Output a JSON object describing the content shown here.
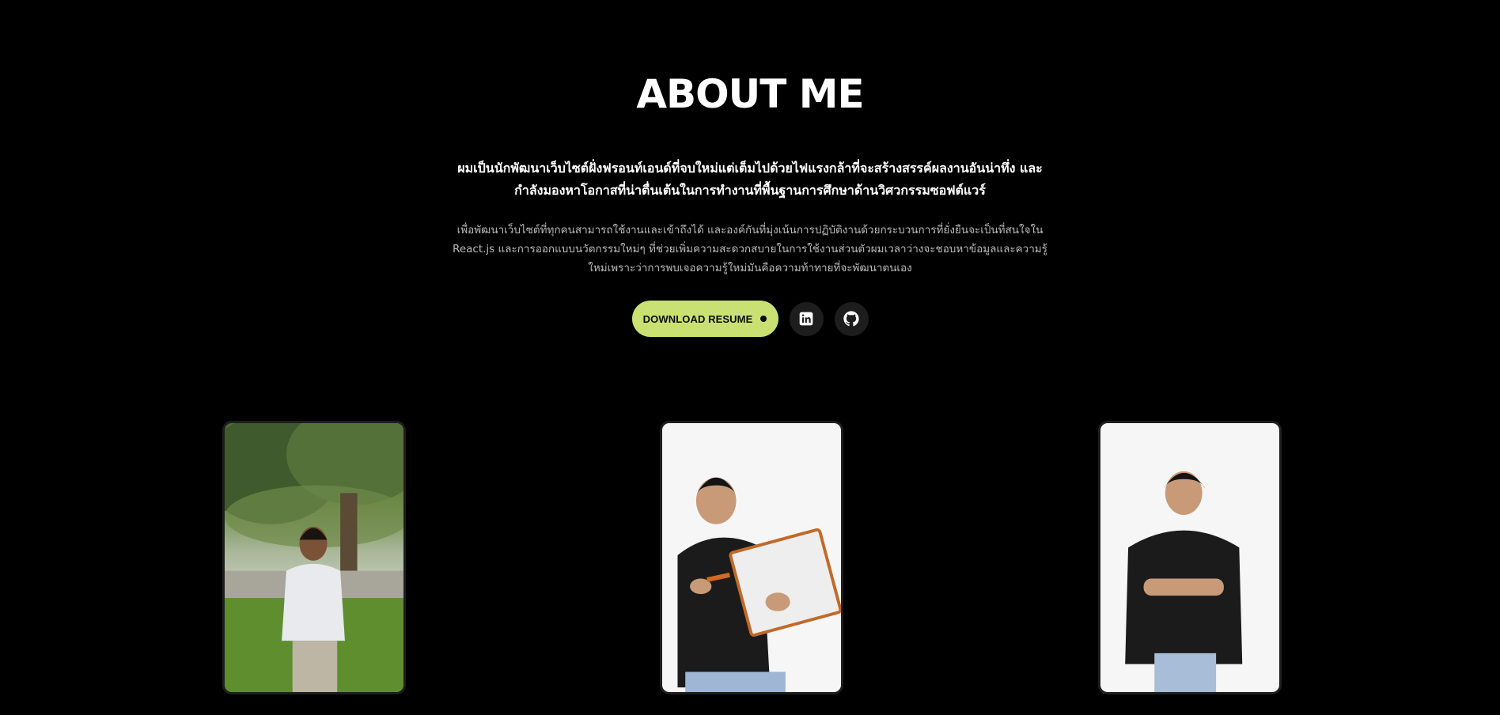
{
  "about": {
    "title": "ABOUT ME",
    "lead": "ผมเป็นนักพัฒนาเว็บไซต์ฝั่งฟรอนท์เอนด์ที่จบใหม่แต่เต็มไปด้วยไฟแรงกล้าที่จะสร้างสรรค์ผลงานอันน่าทึ่ง และกำลังมองหาโอกาสที่น่าตื่นเต้นในการทำงานที่พื้นฐานการศึกษาด้านวิศวกรรมซอฟต์แวร์",
    "body": "เพื่อพัฒนาเว็บไซต์ที่ทุกคนสามารถใช้งานและเข้าถึงได้ และองค์กันที่มุ่งเน้นการปฏิบัติงานด้วยกระบวนการที่ยั่งยืนจะเป็นที่สนใจใน React.js และการออกแบบนวัตกรรมใหม่ๆ ที่ช่วยเพิ่มความสะดวกสบายในการใช้งานส่วนตัวผมเวลาว่างจะชอบหาข้อมูลและความรู้ใหม่เพราะว่าการพบเจอความรู้ใหม่มันคือความท้าทายที่จะพัฒนาตนเอง"
  },
  "actions": {
    "resume_label": "DOWNLOAD RESUME",
    "linkedin_icon": "linkedin-icon",
    "github_icon": "github-icon"
  },
  "photos": [
    {
      "icon": "portrait-photo-outdoor"
    },
    {
      "icon": "portrait-photo-whiteboard"
    },
    {
      "icon": "portrait-photo-arms-crossed"
    }
  ],
  "colors": {
    "background": "#000000",
    "accent": "#c9e172",
    "icon_button_bg": "#1d1d1d",
    "body_text": "#b9b9b9"
  }
}
